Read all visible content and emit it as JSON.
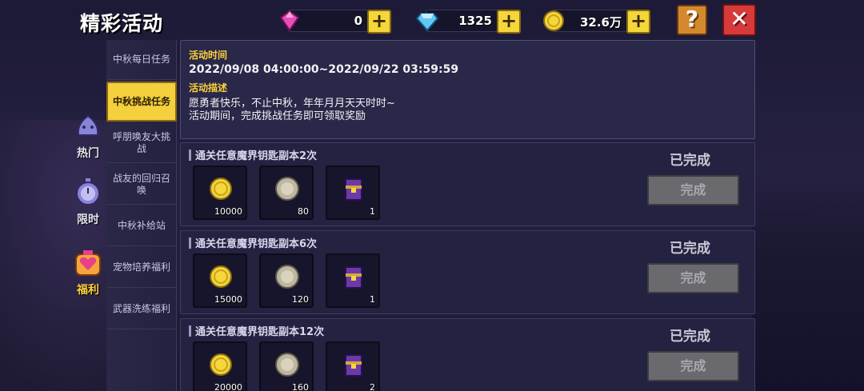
{
  "header": {
    "title": "精彩活动",
    "currencies": [
      {
        "name": "pink-gem",
        "value": "0",
        "color": "#e84db8"
      },
      {
        "name": "blue-diamond",
        "value": "1325",
        "color": "#5fc8f5"
      },
      {
        "name": "gold-coin",
        "value": "32.6万",
        "color": "#f5d63b"
      }
    ],
    "help_label": "?",
    "close_label": "✕"
  },
  "categories": [
    {
      "label": "热门",
      "icon": "slime-icon",
      "active": false
    },
    {
      "label": "限时",
      "icon": "pocket-watch-icon",
      "active": false
    },
    {
      "label": "福利",
      "icon": "heart-bag-icon",
      "active": true
    }
  ],
  "subtabs": [
    {
      "label": "中秋每日任务",
      "active": false
    },
    {
      "label": "中秋挑战任务",
      "active": true
    },
    {
      "label": "呼朋唤友大挑战",
      "active": false
    },
    {
      "label": "战友的回归召唤",
      "active": false
    },
    {
      "label": "中秋补给站",
      "active": false
    },
    {
      "label": "宠物培养福利",
      "active": false
    },
    {
      "label": "武器洗练福利",
      "active": false
    }
  ],
  "info": {
    "time_label": "活动时间",
    "time_value": "2022/09/08 04:00:00~2022/09/22 03:59:59",
    "desc_label": "活动描述",
    "desc_line1": "愿勇者快乐，不止中秋，年年月月天天时时~",
    "desc_line2": "活动期间，完成挑战任务即可领取奖励"
  },
  "tasks": [
    {
      "title": "通关任意魔界钥匙副本2次",
      "status": "已完成",
      "button": "完成",
      "rewards": [
        {
          "icon": "gold-coin-icon",
          "count": "10000"
        },
        {
          "icon": "silver-medal-icon",
          "count": "80"
        },
        {
          "icon": "purple-chest-icon",
          "count": "1"
        }
      ]
    },
    {
      "title": "通关任意魔界钥匙副本6次",
      "status": "已完成",
      "button": "完成",
      "rewards": [
        {
          "icon": "gold-coin-icon",
          "count": "15000"
        },
        {
          "icon": "silver-medal-icon",
          "count": "120"
        },
        {
          "icon": "purple-chest-icon",
          "count": "1"
        }
      ]
    },
    {
      "title": "通关任意魔界钥匙副本12次",
      "status": "已完成",
      "button": "完成",
      "rewards": [
        {
          "icon": "gold-coin-icon",
          "count": "20000"
        },
        {
          "icon": "silver-medal-icon",
          "count": "160"
        },
        {
          "icon": "purple-chest-icon",
          "count": "2"
        }
      ]
    }
  ]
}
